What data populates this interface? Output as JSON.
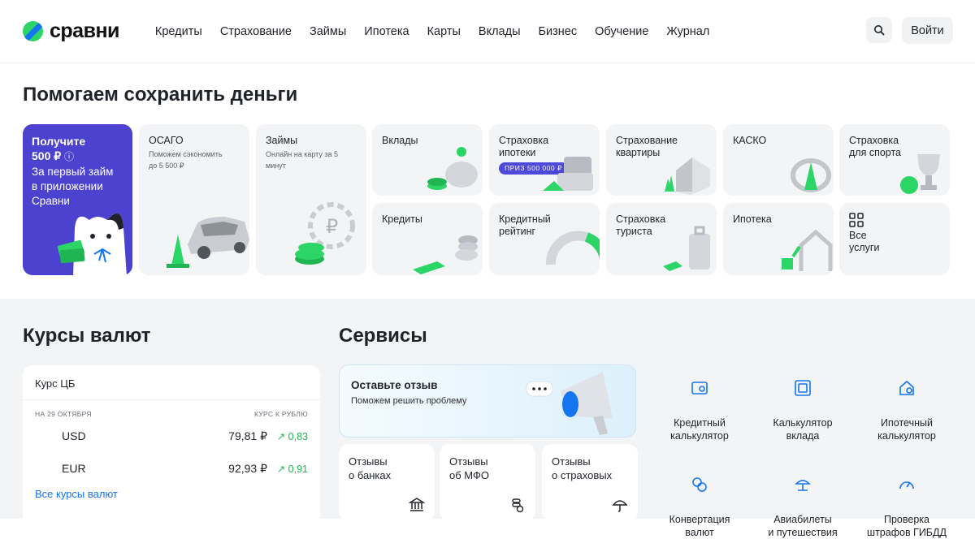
{
  "header": {
    "brand": "сравни",
    "nav": [
      "Кредиты",
      "Страхование",
      "Займы",
      "Ипотека",
      "Карты",
      "Вклады",
      "Бизнес",
      "Обучение",
      "Журнал"
    ],
    "login_label": "Войти"
  },
  "hero": {
    "title": "Помогаем сохранить деньги",
    "promo": {
      "title": "Получите\n500 ₽",
      "info_icon": "ⓘ",
      "subtitle": "За первый займ\nв приложении\nСравни"
    },
    "tiles": [
      {
        "title": "ОСАГО",
        "subtitle": "Поможем сэкономить\nдо 5 500 ₽"
      },
      {
        "title": "Займы",
        "subtitle": "Онлайн на карту за 5\nминут"
      },
      {
        "title": "Вклады"
      },
      {
        "title": "Страховка\nипотеки",
        "badge": "ПРИЗ 500 000 ₽"
      },
      {
        "title": "Страхование\nквартиры"
      },
      {
        "title": "КАСКО"
      },
      {
        "title": "Страховка\nдля спорта"
      },
      {
        "title": "Кредиты"
      },
      {
        "title": "Кредитный\nрейтинг"
      },
      {
        "title": "Страховка\nтуриста"
      },
      {
        "title": "Ипотека"
      },
      {
        "title": "Все\nуслуги"
      }
    ]
  },
  "rates": {
    "section_title": "Курсы валют",
    "card_title": "Курс ЦБ",
    "date_label": "НА 29 ОКТЯБРЯ",
    "rub_label": "КУРС К РУБЛЮ",
    "rows": [
      {
        "currency": "USD",
        "value": "79,81 ₽",
        "change": "↗ 0,83"
      },
      {
        "currency": "EUR",
        "value": "92,93 ₽",
        "change": "↗ 0,91"
      }
    ],
    "all_link": "Все курсы валют"
  },
  "services": {
    "section_title": "Сервисы",
    "feedback": {
      "title": "Оставьте отзыв",
      "subtitle": "Поможем решить проблему"
    },
    "reviews": [
      {
        "label": "Отзывы\nо банках"
      },
      {
        "label": "Отзывы\nоб МФО"
      },
      {
        "label": "Отзывы\nо страховых"
      }
    ],
    "items": [
      {
        "label": "Кредитный\nкалькулятор",
        "icon": "credit-calculator-icon"
      },
      {
        "label": "Калькулятор\nвклада",
        "icon": "deposit-calculator-icon"
      },
      {
        "label": "Ипотечный\nкалькулятор",
        "icon": "mortgage-calculator-icon"
      },
      {
        "label": "Конвертация\nвалют",
        "icon": "currency-exchange-icon"
      },
      {
        "label": "Авиабилеты\nи путешествия",
        "icon": "travel-icon"
      },
      {
        "label": "Проверка\nштрафов ГИБДД",
        "icon": "speedometer-icon"
      }
    ]
  },
  "colors": {
    "accent_green": "#2bd566",
    "brand_blue": "#1574f0",
    "promo_purple": "#4b43d0"
  }
}
